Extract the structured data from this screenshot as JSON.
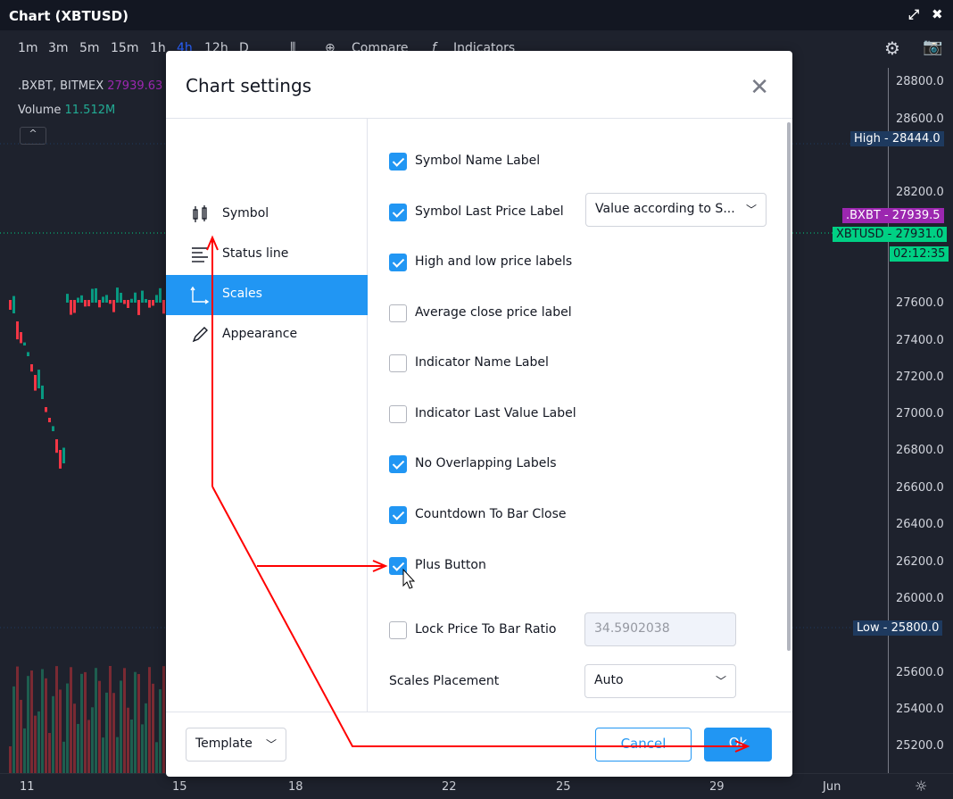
{
  "window": {
    "title": "Chart (XBTUSD)"
  },
  "toolbar": {
    "intervals": [
      "1m",
      "3m",
      "5m",
      "15m",
      "1h",
      "4h",
      "12h",
      "D"
    ],
    "active_interval": "4h",
    "compare": "Compare",
    "indicators": "Indicators"
  },
  "legend": {
    "symbol": ".BXBT, BITMEX",
    "symbol_value": "27939.63",
    "volume_label": "Volume",
    "volume_value": "11.512M"
  },
  "price_axis": {
    "ticks": [
      "28800.0",
      "28600.0",
      "28200.0",
      "27600.0",
      "27400.0",
      "27200.0",
      "27000.0",
      "26800.0",
      "26600.0",
      "26400.0",
      "26200.0",
      "26000.0",
      "25600.0",
      "25400.0",
      "25200.0"
    ],
    "high": {
      "label": "High",
      "value": "28444.0"
    },
    "bxbt": {
      "label": ".BXBT",
      "value": "27939.5"
    },
    "xbtusd": {
      "label": "XBTUSD",
      "value": "27931.0"
    },
    "countdown": "02:12:35",
    "low": {
      "label": "Low",
      "value": "25800.0"
    }
  },
  "time_axis": {
    "ticks": [
      "11",
      "15",
      "18",
      "22",
      "25",
      "29",
      "Jun"
    ]
  },
  "colors": {
    "accent": "#2196f3",
    "up": "#089981",
    "down": "#f23645",
    "bxbt": "#9c27b0",
    "xbtusd": "#00d084",
    "high_low": "#1e3a5f"
  },
  "dialog": {
    "title": "Chart settings",
    "sidebar": [
      {
        "label": "Symbol",
        "icon": "candles-icon"
      },
      {
        "label": "Status line",
        "icon": "lines-icon"
      },
      {
        "label": "Scales",
        "icon": "scales-icon",
        "active": true
      },
      {
        "label": "Appearance",
        "icon": "pencil-icon"
      }
    ],
    "options": [
      {
        "label": "Symbol Name Label",
        "checked": true
      },
      {
        "label": "Symbol Last Price Label",
        "checked": true,
        "select": "Value according to S..."
      },
      {
        "label": "High and low price labels",
        "checked": true
      },
      {
        "label": "Average close price label",
        "checked": false
      },
      {
        "label": "Indicator Name Label",
        "checked": false
      },
      {
        "label": "Indicator Last Value Label",
        "checked": false
      },
      {
        "label": "No Overlapping Labels",
        "checked": true
      },
      {
        "label": "Countdown To Bar Close",
        "checked": true
      },
      {
        "label": "Plus Button",
        "checked": true
      },
      {
        "label": "Lock Price To Bar Ratio",
        "checked": false,
        "input": "34.5902038"
      }
    ],
    "scales_placement": {
      "label": "Scales Placement",
      "value": "Auto"
    },
    "footer": {
      "template": "Template",
      "cancel": "Cancel",
      "ok": "Ok"
    }
  }
}
